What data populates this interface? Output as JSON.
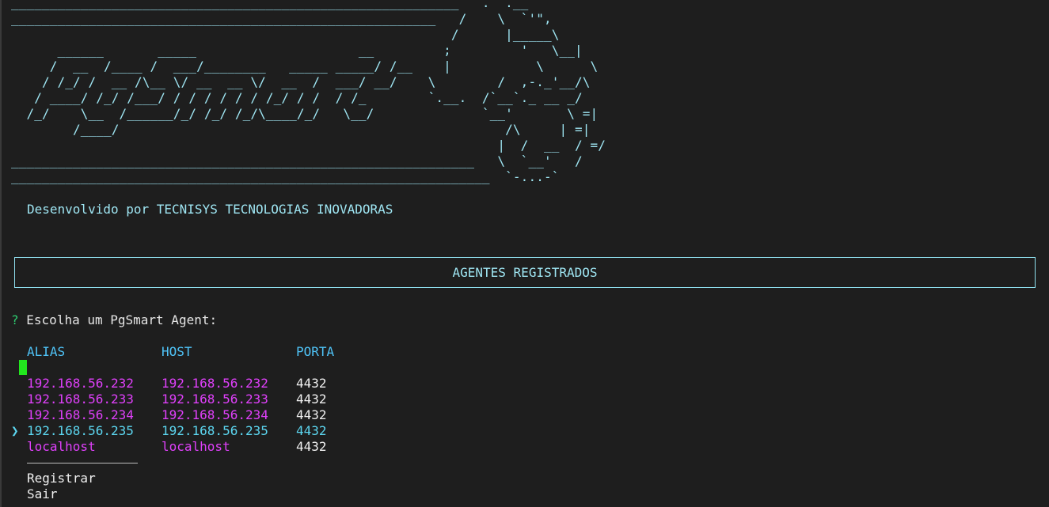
{
  "banner": {
    "art": "__________________________________________________________   .  .__\n_______________________________________________________   /    \\  `'\",\n                                                         /      |_____\\\n      ______       _____                     __         ;         '   \\__|\n     /  __  /____ /  ___/________   _____ _____/ /__    |           \\      \\\n    / /_/ /  __ /\\__ \\/ __  __ \\/  __  /  ___/ __/    \\        /  ,-._'__/\\\n   / ____/ /_/ /___/ / / / / / / /_/ / /  / /_        `.__.  /`__`._ __ _/\n  /_/    \\__  /______/_/ /_/ /_/\\____/_/   \\__/              `__'       \\ =|\n        /____/                                                  /\\     | =|\n                                                               |  /  __  / =/\n____________________________________________________________   \\  `__'   /\n______________________________________________________________  `-...-`",
    "credit": "Desenvolvido por TECNISYS TECNOLOGIAS INOVADORAS"
  },
  "section": {
    "title": "AGENTES REGISTRADOS"
  },
  "prompt": {
    "symbol": "?",
    "question": "Escolha um PgSmart Agent:"
  },
  "table": {
    "headers": {
      "alias": "ALIAS",
      "host": "HOST",
      "port": "PORTA"
    },
    "pointer": "❯",
    "rows": [
      {
        "alias": "192.168.56.232",
        "host": "192.168.56.232",
        "port": "4432"
      },
      {
        "alias": "192.168.56.233",
        "host": "192.168.56.233",
        "port": "4432"
      },
      {
        "alias": "192.168.56.234",
        "host": "192.168.56.234",
        "port": "4432"
      },
      {
        "alias": "192.168.56.235",
        "host": "192.168.56.235",
        "port": "4432"
      },
      {
        "alias": "localhost",
        "host": "localhost",
        "port": "4432"
      }
    ]
  },
  "menu": {
    "register": "Registrar",
    "exit": "Sair"
  },
  "colors": {
    "background": "#1e1e1e",
    "banner": "#9fe6f3",
    "header": "#4fc3f7",
    "choice": "#e040fb",
    "selected": "#5cd6f0",
    "prompt_mark": "#2ecc71",
    "cursor": "#22e61e"
  }
}
